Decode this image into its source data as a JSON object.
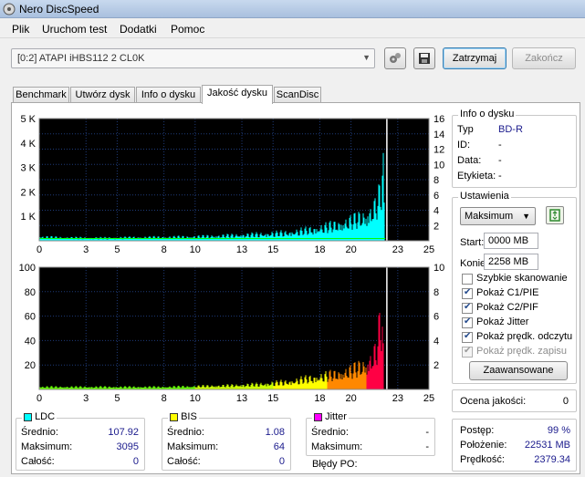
{
  "window": {
    "title": "Nero DiscSpeed"
  },
  "menu": [
    "Plik",
    "Uruchom test",
    "Dodatki",
    "Pomoc"
  ],
  "toolbar": {
    "drive": "[0:2]   ATAPI iHBS112   2 CL0K",
    "stop_label": "Zatrzymaj",
    "finish_label": "Zakończ"
  },
  "tabs": [
    "Benchmark",
    "Utwórz dysk",
    "Info o dysku",
    "Jakość dysku",
    "ScanDisc"
  ],
  "active_tab": "Jakość dysku",
  "disc_info": {
    "title": "Info o dysku",
    "type_label": "Typ",
    "type_value": "BD-R",
    "id_label": "ID:",
    "id_value": "-",
    "date_label": "Data:",
    "date_value": "-",
    "label_label": "Etykieta:",
    "label_value": "-"
  },
  "settings": {
    "title": "Ustawienia",
    "speed": "Maksimum",
    "start_label": "Start:",
    "start_value": "0000 MB",
    "end_label": "Koniec:",
    "end_value": "2258 MB",
    "quick_scan": "Szybkie skanowanie",
    "show_c1": "Pokaż C1/PIE",
    "show_c2": "Pokaż C2/PIF",
    "show_jitter": "Pokaż Jitter",
    "show_read_speed": "Pokaż prędk. odczytu",
    "show_write_speed": "Pokaż prędk. zapisu",
    "advanced": "Zaawansowane"
  },
  "quality": {
    "label": "Ocena jakości:",
    "value": "0"
  },
  "progress": {
    "progress_label": "Postęp:",
    "progress_value": "99 %",
    "position_label": "Położenie:",
    "position_value": "22531 MB",
    "speed_label": "Prędkość:",
    "speed_value": "2379.34"
  },
  "stats": {
    "ldc": {
      "title": "LDC",
      "avg_label": "Średnio:",
      "avg": "107.92",
      "max_label": "Maksimum:",
      "max": "3095",
      "total_label": "Całość:",
      "total": "0"
    },
    "bis": {
      "title": "BIS",
      "avg_label": "Średnio:",
      "avg": "1.08",
      "max_label": "Maksimum:",
      "max": "64",
      "total_label": "Całość:",
      "total": "0"
    },
    "jitter": {
      "title": "Jitter",
      "avg_label": "Średnio:",
      "avg": "-",
      "max_label": "Maksimum:",
      "max": "-",
      "po_label": "Błędy PO:",
      "po": ""
    }
  },
  "colors": {
    "ldc": "#00ffff",
    "bis": "#ffff00",
    "jitter": "#ff00ff",
    "plot_bg": "#000000",
    "grid": "#1e3a78",
    "read_speed": "#00ff00"
  },
  "chart_data": [
    {
      "type": "bar",
      "x_ticks": [
        0,
        3,
        5,
        8,
        10,
        13,
        15,
        18,
        20,
        23,
        25
      ],
      "y_left_ticks": [
        "1 K",
        "2 K",
        "3 K",
        "4 K",
        "5 K"
      ],
      "y_right_ticks": [
        2,
        4,
        6,
        8,
        10,
        12,
        14,
        16
      ],
      "xlim": [
        0,
        25
      ],
      "ylim": [
        0,
        5000
      ],
      "y2lim": [
        0,
        16
      ],
      "grid": true,
      "series": [
        {
          "name": "LDC",
          "points": [
            [
              0,
              150
            ],
            [
              2,
              120
            ],
            [
              4,
              110
            ],
            [
              6,
              130
            ],
            [
              8,
              140
            ],
            [
              10,
              160
            ],
            [
              12,
              200
            ],
            [
              14,
              250
            ],
            [
              16,
              320
            ],
            [
              17,
              400
            ],
            [
              18,
              500
            ],
            [
              19,
              620
            ],
            [
              20,
              780
            ],
            [
              21,
              1000
            ],
            [
              21.5,
              1300
            ],
            [
              21.9,
              1800
            ],
            [
              22.05,
              3095
            ],
            [
              22.15,
              900
            ]
          ]
        },
        {
          "name": "read_speed",
          "points": [
            [
              0,
              0.3
            ],
            [
              22.2,
              0.3
            ]
          ]
        }
      ],
      "marker_x": 22.3
    },
    {
      "type": "bar",
      "x_ticks": [
        0,
        3,
        5,
        8,
        10,
        13,
        15,
        18,
        20,
        23,
        25
      ],
      "y_left_ticks": [
        20,
        40,
        60,
        80,
        100
      ],
      "y_right_ticks": [
        2,
        4,
        6,
        8,
        10
      ],
      "xlim": [
        0,
        25
      ],
      "ylim": [
        0,
        100
      ],
      "y2lim": [
        0,
        10
      ],
      "grid": true,
      "series": [
        {
          "name": "BIS",
          "points": [
            [
              0,
              2
            ],
            [
              4,
              2
            ],
            [
              8,
              2
            ],
            [
              12,
              3
            ],
            [
              14,
              4
            ],
            [
              16,
              6
            ],
            [
              17,
              8
            ],
            [
              18,
              10
            ],
            [
              19,
              12
            ],
            [
              20,
              15
            ],
            [
              21,
              20
            ],
            [
              21.6,
              30
            ],
            [
              22,
              60
            ],
            [
              22.1,
              15
            ]
          ]
        }
      ],
      "marker_x": 22.3
    }
  ]
}
